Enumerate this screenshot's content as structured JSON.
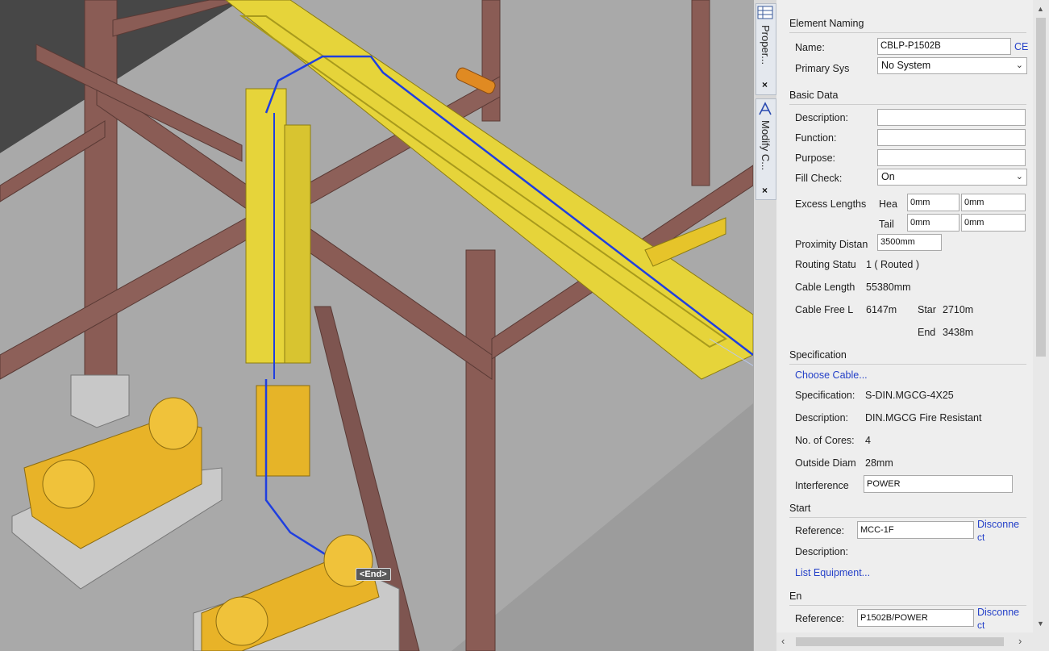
{
  "viewport": {
    "end_marker": "<End>"
  },
  "side_tabs": [
    {
      "label": "Proper...",
      "close": "×",
      "icon": "table-icon"
    },
    {
      "label": "Modify C...",
      "close": "×",
      "icon": "route-icon"
    }
  ],
  "panel": {
    "element_naming": {
      "heading": "Element Naming",
      "name_label": "Name:",
      "name_value": "CBLP-P1502B",
      "ce_link": "CE",
      "primary_sys_label": "Primary Sys",
      "primary_sys_value": "No System"
    },
    "basic_data": {
      "heading": "Basic Data",
      "description_label": "Description:",
      "description_value": "",
      "function_label": "Function:",
      "function_value": "",
      "purpose_label": "Purpose:",
      "purpose_value": "",
      "fill_check_label": "Fill Check:",
      "fill_check_value": "On",
      "excess_lengths_label": "Excess Lengths",
      "head_label": "Hea",
      "head_value_1": "0mm",
      "head_value_2": "0mm",
      "tail_label": "Tail",
      "tail_value_1": "0mm",
      "tail_value_2": "0mm",
      "proximity_label": "Proximity  Distan",
      "proximity_value": "3500mm",
      "routing_label": "Routing Statu",
      "routing_value": "1 ( Routed )",
      "cable_length_label": "Cable Length",
      "cable_length_value": "55380mm",
      "cable_free_label": "Cable  Free L",
      "cable_free_value": "6147m",
      "start_label": "Star",
      "start_value": "2710m",
      "end_label": "End",
      "end_value": "3438m"
    },
    "specification": {
      "heading": "Specification",
      "choose_cable_link": "Choose Cable...",
      "spec_label": "Specification:",
      "spec_value": "S-DIN.MGCG-4X25",
      "desc_label": "Description:",
      "desc_value": "DIN.MGCG Fire Resistant",
      "cores_label": "No. of Cores:",
      "cores_value": "4",
      "od_label": "Outside Diam",
      "od_value": "28mm",
      "interference_label": "Interference",
      "interference_value": "POWER"
    },
    "start": {
      "heading": "Start",
      "reference_label": "Reference:",
      "reference_value": "MCC-1F",
      "disconnect_link_1": "Disconne",
      "disconnect_link_2": "ct",
      "description_label": "Description:",
      "list_equipment_link": "List Equipment..."
    },
    "end": {
      "heading": "En",
      "reference_label": "Reference:",
      "reference_value": "P1502B/POWER",
      "disconnect_link_1": "Disconne",
      "disconnect_link_2": "ct"
    }
  },
  "colors": {
    "tray_yellow": "#e6d43a",
    "steel_brown": "#8b6058",
    "route_blue": "#1f3fe0",
    "pump_gold": "#e8b328",
    "link_blue": "#2440c8",
    "panel_bg": "#eeeeee"
  }
}
